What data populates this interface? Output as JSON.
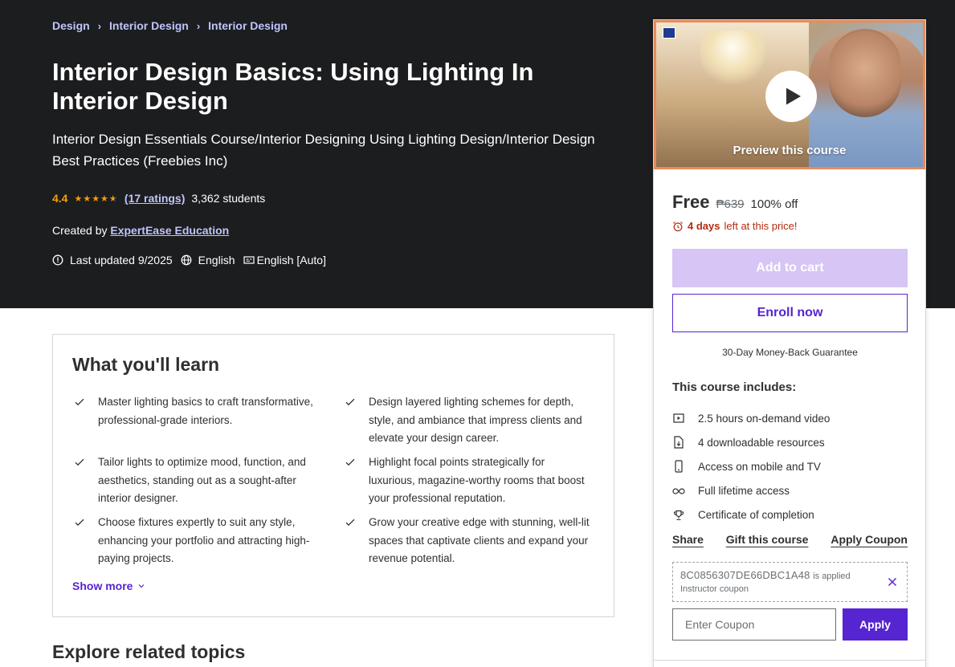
{
  "breadcrumb": [
    "Design",
    "Interior Design",
    "Interior Design"
  ],
  "course": {
    "title": "Interior Design Basics: Using Lighting In Interior Design",
    "subtitle": "Interior Design Essentials Course/Interior Designing Using Lighting Design/Interior Design Best Practices (Freebies Inc)",
    "rating": "4.4",
    "stars_rating": 4.4,
    "ratings_count": "(17 ratings)",
    "students": "3,362 students",
    "created_by_label": "Created by",
    "instructor": "ExpertEase Education",
    "last_updated": "Last updated 9/2025",
    "language": "English",
    "captions": "English [Auto]"
  },
  "sidebar": {
    "preview_label": "Preview this course",
    "price": "Free",
    "original_price": "₱639",
    "discount": "100% off",
    "timer_bold": "4 days",
    "timer_rest": "left at this price!",
    "add_to_cart": "Add to cart",
    "enroll": "Enroll now",
    "guarantee": "30-Day Money-Back Guarantee",
    "includes_title": "This course includes:",
    "includes": [
      {
        "icon": "video-icon",
        "label": "2.5 hours on-demand video"
      },
      {
        "icon": "download-file-icon",
        "label": "4 downloadable resources"
      },
      {
        "icon": "mobile-icon",
        "label": "Access on mobile and TV"
      },
      {
        "icon": "infinity-icon",
        "label": "Full lifetime access"
      },
      {
        "icon": "trophy-icon",
        "label": "Certificate of completion"
      }
    ],
    "links": {
      "share": "Share",
      "gift": "Gift this course",
      "apply_coupon": "Apply Coupon"
    },
    "coupon": {
      "code": "8C0856307DE66DBC1A48",
      "applied": "is applied",
      "type": "Instructor coupon"
    },
    "coupon_placeholder": "Enter Coupon",
    "apply": "Apply"
  },
  "learn": {
    "title": "What you'll learn",
    "items": [
      "Master lighting basics to craft transformative, professional-grade interiors.",
      "Design layered lighting schemes for depth, style, and ambiance that impress clients and elevate your design career.",
      "Tailor lights to optimize mood, function, and aesthetics, standing out as a sought-after interior designer.",
      "Highlight focal points strategically for luxurious, magazine-worthy rooms that boost your professional reputation.",
      "Choose fixtures expertly to suit any style, enhancing your portfolio and attracting high-paying projects.",
      "Grow your creative edge with stunning, well-lit spaces that captivate clients and expand your revenue potential."
    ],
    "show_more": "Show more"
  },
  "related_title": "Explore related topics",
  "colors": {
    "hero_bg": "#1c1d1f",
    "link_light": "#c0c4fc",
    "star": "#f69c08",
    "brand_purple": "#5624d0",
    "cart_disabled": "#d6c5f5",
    "timer_red": "#b32d0f",
    "preview_border": "#e58c5b"
  }
}
